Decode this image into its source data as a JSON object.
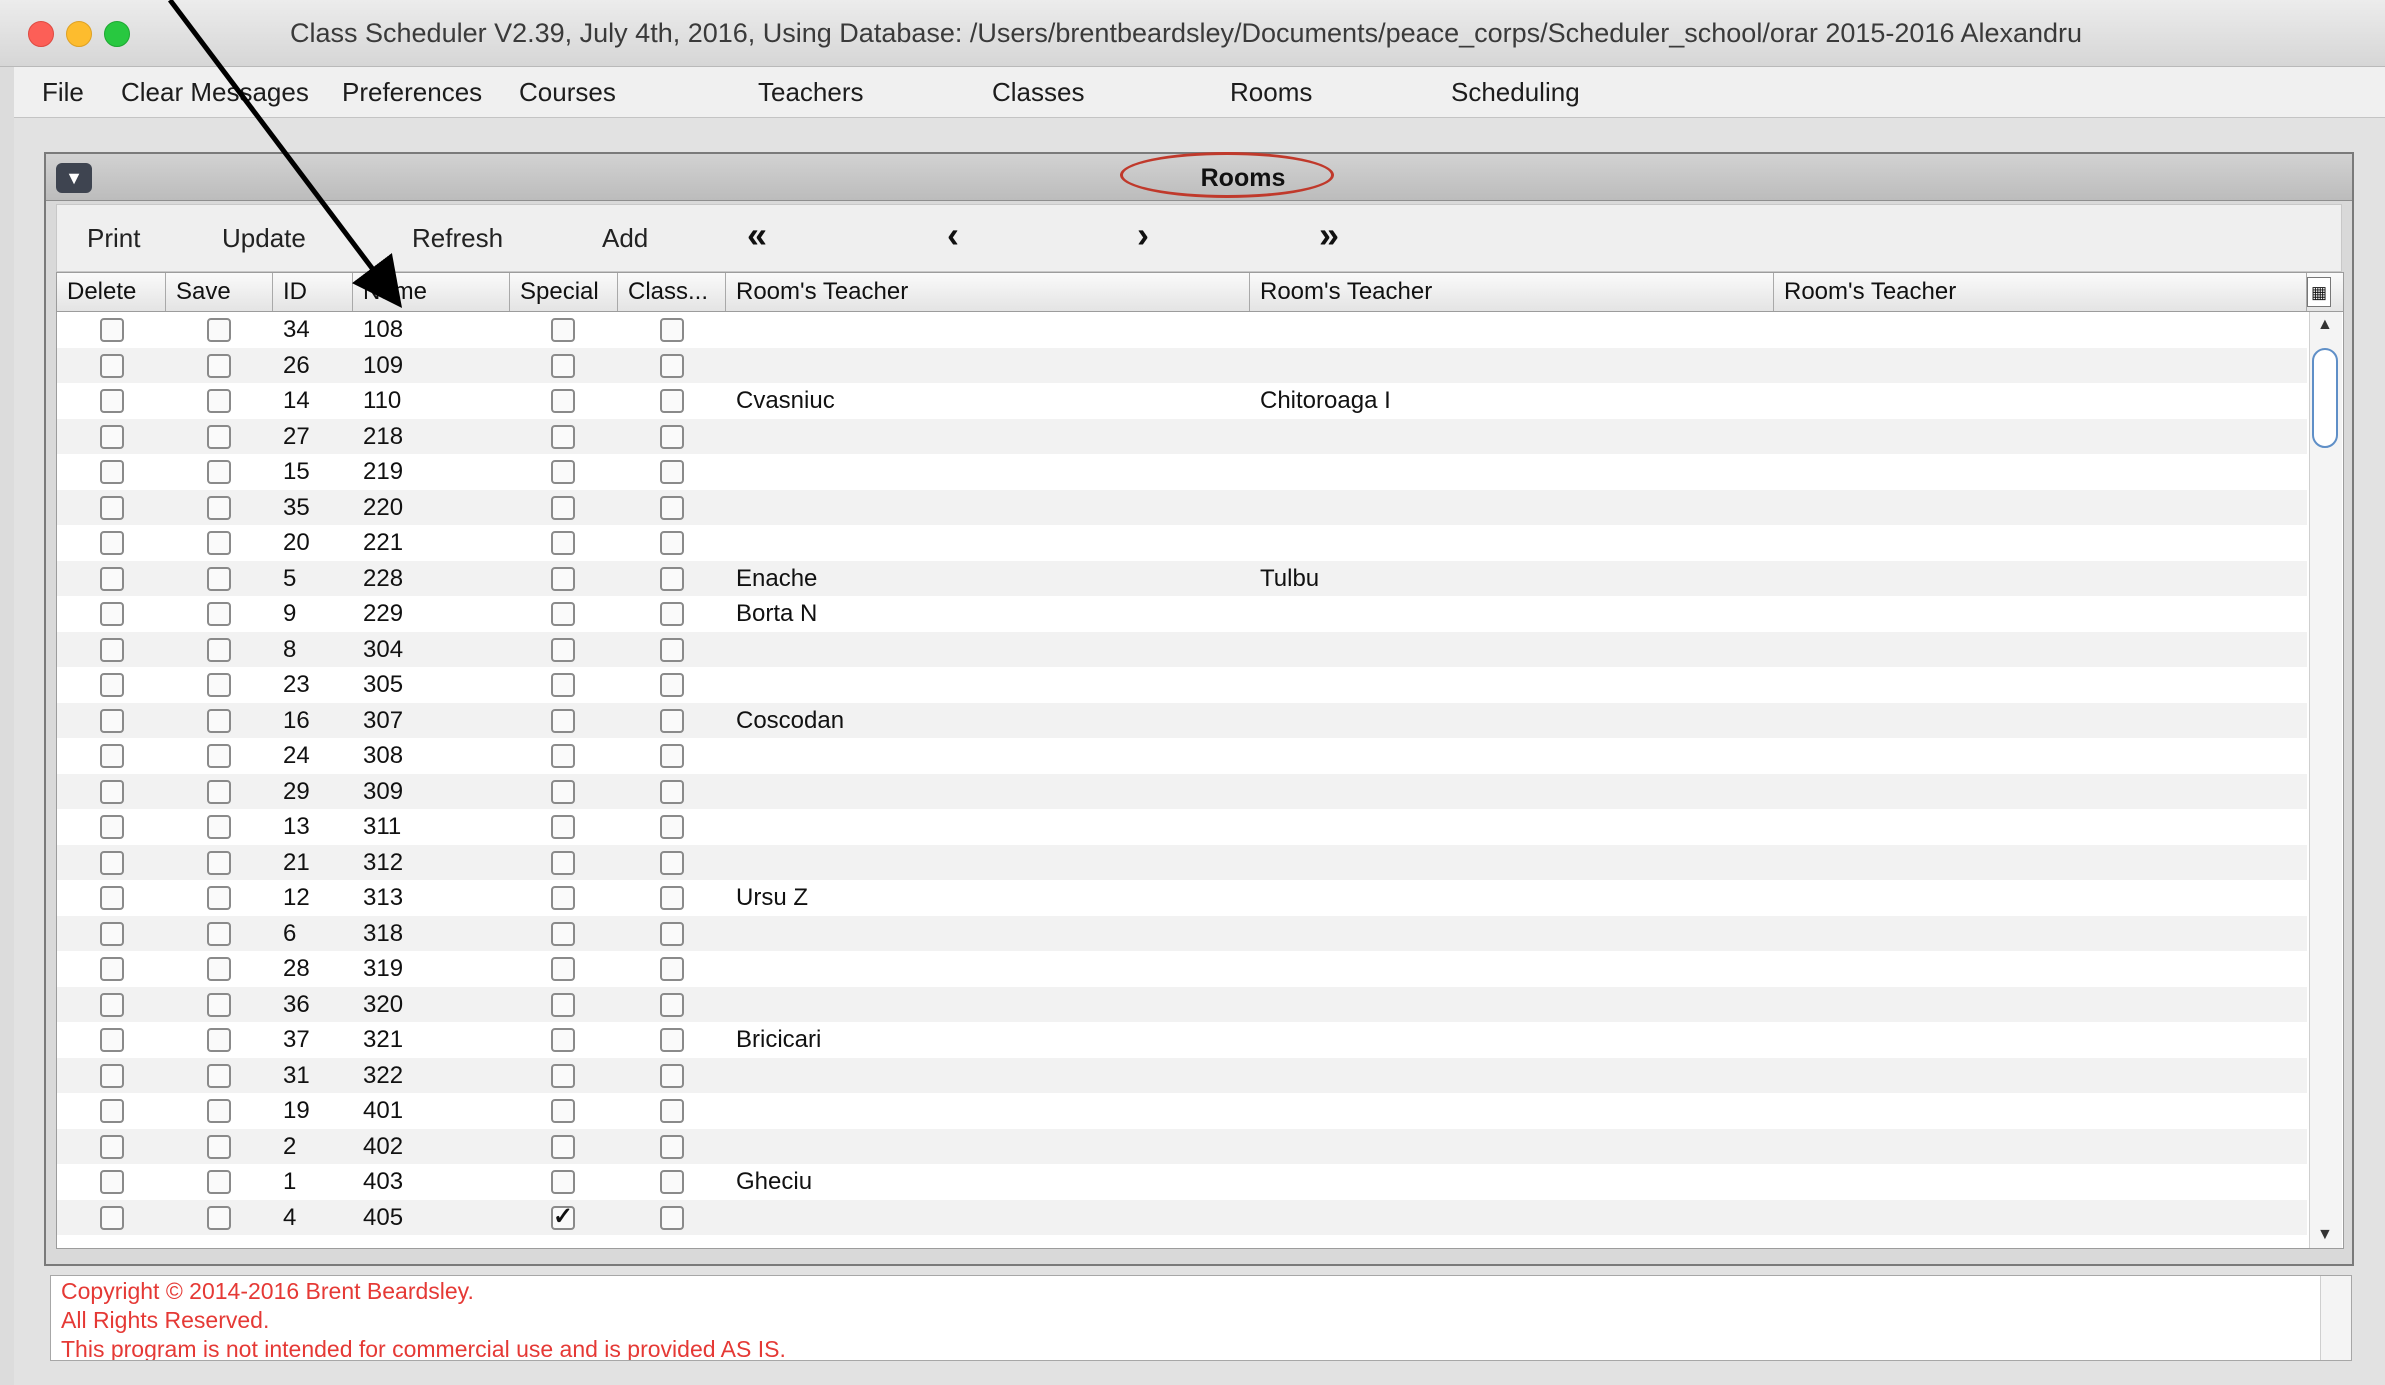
{
  "window": {
    "title": "Class Scheduler V2.39, July 4th, 2016, Using Database: /Users/brentbeardsley/Documents/peace_corps/Scheduler_school/orar 2015-2016 Alexandru"
  },
  "menu": [
    "File",
    "Clear Messages",
    "Preferences",
    "Courses",
    "Teachers",
    "Classes",
    "Rooms",
    "Scheduling"
  ],
  "panel": {
    "title": "Rooms",
    "collapse_icon": "chevron-down-icon"
  },
  "toolbar": {
    "print": "Print",
    "update": "Update",
    "refresh": "Refresh",
    "add": "Add",
    "first": "«",
    "prev": "‹",
    "next": "›",
    "last": "»"
  },
  "table": {
    "headers": [
      "Delete",
      "Save",
      "ID",
      "Name",
      "Special",
      "Class...",
      "Room's Teacher",
      "Room's Teacher",
      "Room's Teacher"
    ],
    "rows": [
      {
        "id": "34",
        "name": "108",
        "special": false,
        "t1": "",
        "t2": "",
        "t3": ""
      },
      {
        "id": "26",
        "name": "109",
        "special": false,
        "t1": "",
        "t2": "",
        "t3": ""
      },
      {
        "id": "14",
        "name": "110",
        "special": false,
        "t1": "Cvasniuc",
        "t2": "Chitoroaga I",
        "t3": ""
      },
      {
        "id": "27",
        "name": "218",
        "special": false,
        "t1": "",
        "t2": "",
        "t3": ""
      },
      {
        "id": "15",
        "name": "219",
        "special": false,
        "t1": "",
        "t2": "",
        "t3": ""
      },
      {
        "id": "35",
        "name": "220",
        "special": false,
        "t1": "",
        "t2": "",
        "t3": ""
      },
      {
        "id": "20",
        "name": "221",
        "special": false,
        "t1": "",
        "t2": "",
        "t3": ""
      },
      {
        "id": "5",
        "name": "228",
        "special": false,
        "t1": "Enache",
        "t2": "Tulbu",
        "t3": ""
      },
      {
        "id": "9",
        "name": "229",
        "special": false,
        "t1": "Borta N",
        "t2": "",
        "t3": ""
      },
      {
        "id": "8",
        "name": "304",
        "special": false,
        "t1": "",
        "t2": "",
        "t3": ""
      },
      {
        "id": "23",
        "name": "305",
        "special": false,
        "t1": "",
        "t2": "",
        "t3": ""
      },
      {
        "id": "16",
        "name": "307",
        "special": false,
        "t1": "Coscodan",
        "t2": "",
        "t3": ""
      },
      {
        "id": "24",
        "name": "308",
        "special": false,
        "t1": "",
        "t2": "",
        "t3": ""
      },
      {
        "id": "29",
        "name": "309",
        "special": false,
        "t1": "",
        "t2": "",
        "t3": ""
      },
      {
        "id": "13",
        "name": "311",
        "special": false,
        "t1": "",
        "t2": "",
        "t3": ""
      },
      {
        "id": "21",
        "name": "312",
        "special": false,
        "t1": "",
        "t2": "",
        "t3": ""
      },
      {
        "id": "12",
        "name": "313",
        "special": false,
        "t1": "Ursu Z",
        "t2": "",
        "t3": ""
      },
      {
        "id": "6",
        "name": "318",
        "special": false,
        "t1": "",
        "t2": "",
        "t3": ""
      },
      {
        "id": "28",
        "name": "319",
        "special": false,
        "t1": "",
        "t2": "",
        "t3": ""
      },
      {
        "id": "36",
        "name": "320",
        "special": false,
        "t1": "",
        "t2": "",
        "t3": ""
      },
      {
        "id": "37",
        "name": "321",
        "special": false,
        "t1": "Bricicari",
        "t2": "",
        "t3": ""
      },
      {
        "id": "31",
        "name": "322",
        "special": false,
        "t1": "",
        "t2": "",
        "t3": ""
      },
      {
        "id": "19",
        "name": "401",
        "special": false,
        "t1": "",
        "t2": "",
        "t3": ""
      },
      {
        "id": "2",
        "name": "402",
        "special": false,
        "t1": "",
        "t2": "",
        "t3": ""
      },
      {
        "id": "1",
        "name": "403",
        "special": false,
        "t1": "Gheciu",
        "t2": "",
        "t3": ""
      },
      {
        "id": "4",
        "name": "405",
        "special": true,
        "t1": "",
        "t2": "",
        "t3": ""
      }
    ]
  },
  "messages": [
    "Copyright © 2014-2016 Brent Beardsley.",
    "All Rights Reserved.",
    "This program is not intended for commercial use and is provided AS IS."
  ],
  "colors": {
    "highlight_ring": "#c0392b",
    "message_text": "#e53935",
    "arrow": "#000000"
  }
}
